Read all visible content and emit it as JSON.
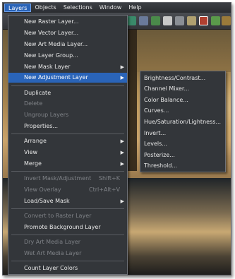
{
  "menubar": {
    "items": [
      "Layers",
      "Objects",
      "Selections",
      "Window",
      "Help"
    ]
  },
  "layers_menu": {
    "items": [
      {
        "label": "New Raster Layer...",
        "enabled": true
      },
      {
        "label": "New Vector Layer...",
        "enabled": true
      },
      {
        "label": "New Art Media Layer...",
        "enabled": true
      },
      {
        "label": "New Layer Group...",
        "enabled": true
      },
      {
        "label": "New Mask Layer",
        "enabled": true,
        "submenu": true
      },
      {
        "label": "New Adjustment Layer",
        "enabled": true,
        "submenu": true,
        "highlighted": true
      },
      {
        "label": "Duplicate",
        "enabled": true
      },
      {
        "label": "Delete",
        "enabled": false
      },
      {
        "label": "Ungroup Layers",
        "enabled": false
      },
      {
        "label": "Properties...",
        "enabled": true
      },
      {
        "label": "Arrange",
        "enabled": true,
        "submenu": true
      },
      {
        "label": "View",
        "enabled": true,
        "submenu": true
      },
      {
        "label": "Merge",
        "enabled": true,
        "submenu": true
      },
      {
        "label": "Invert Mask/Adjustment",
        "enabled": false,
        "shortcut": "Shift+K"
      },
      {
        "label": "View Overlay",
        "enabled": false,
        "shortcut": "Ctrl+Alt+V"
      },
      {
        "label": "Load/Save Mask",
        "enabled": true,
        "submenu": true
      },
      {
        "label": "Convert to Raster Layer",
        "enabled": false
      },
      {
        "label": "Promote Background Layer",
        "enabled": true
      },
      {
        "label": "Dry Art Media Layer",
        "enabled": false
      },
      {
        "label": "Wet Art Media Layer",
        "enabled": false
      },
      {
        "label": "Count Layer Colors",
        "enabled": true
      }
    ]
  },
  "adjustment_submenu": {
    "items": [
      "Brightness/Contrast...",
      "Channel Mixer...",
      "Color Balance...",
      "Curves...",
      "Hue/Saturation/Lightness...",
      "Invert...",
      "Levels...",
      "Posterize...",
      "Threshold..."
    ]
  },
  "toolbar": {
    "icons": [
      "layer-icon",
      "mask-icon",
      "tree-icon",
      "color-swatch-icon",
      "grid-icon",
      "image-icon",
      "photo-icon",
      "palette-icon",
      "history-icon"
    ]
  }
}
